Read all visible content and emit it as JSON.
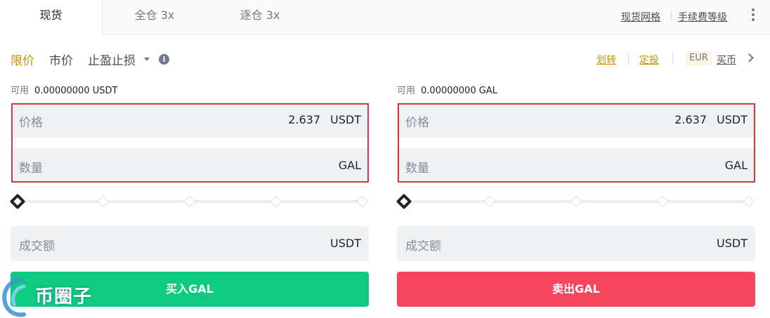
{
  "tabs": [
    {
      "label": "现货",
      "active": true
    },
    {
      "label": "全仓 3x",
      "active": false
    },
    {
      "label": "逐仓 3x",
      "active": false
    }
  ],
  "top_links": {
    "grid": "现货网格",
    "fee": "手续费等级"
  },
  "order_types": {
    "limit": "限价",
    "market": "市价",
    "stop": "止盈止损"
  },
  "right_links": {
    "transfer": "划转",
    "dca": "定投",
    "currency": "EUR",
    "buy": "买币"
  },
  "buy": {
    "avail_label": "可用",
    "avail_value": "0.00000000 USDT",
    "price_label": "价格",
    "price_value": "2.637",
    "price_unit": "USDT",
    "qty_label": "数量",
    "qty_unit": "GAL",
    "total_label": "成交额",
    "total_unit": "USDT",
    "button": "买入GAL"
  },
  "sell": {
    "avail_label": "可用",
    "avail_value": "0.00000000 GAL",
    "price_label": "价格",
    "price_value": "2.637",
    "price_unit": "USDT",
    "qty_label": "数量",
    "qty_unit": "GAL",
    "total_label": "成交额",
    "total_unit": "USDT",
    "button": "卖出GAL"
  },
  "slider_percent": 0,
  "watermark": "币圈子",
  "colors": {
    "accent": "#c99400",
    "buy": "#0ecb81",
    "sell": "#f6465d",
    "highlight": "#d9363e"
  }
}
